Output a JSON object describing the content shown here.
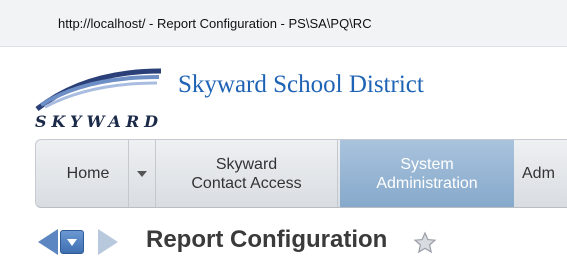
{
  "window": {
    "title": "http://localhost/ - Report Configuration - PS\\SA\\PQ\\RC"
  },
  "header": {
    "logo_text": "SKYWARD",
    "district_name": "Skyward School District"
  },
  "menubar": {
    "items": [
      {
        "label": "Home",
        "active": false
      },
      {
        "label": "Skyward\nContact Access",
        "active": false
      },
      {
        "label": "System\nAdministration",
        "active": true
      },
      {
        "label": "Adm",
        "active": false
      }
    ],
    "home_dropdown_icon": "chevron-down-icon"
  },
  "page": {
    "title": "Report Configuration",
    "favorite_icon": "star-icon"
  },
  "colors": {
    "district_name": "#1f63b5",
    "menu_active_bg": "#8fb0d2",
    "nav_arrow": "#5b86c1"
  }
}
